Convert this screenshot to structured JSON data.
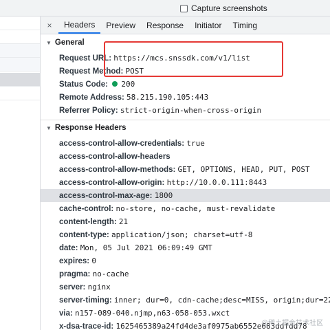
{
  "capture": {
    "label": "Capture screenshots"
  },
  "tabs": {
    "close_icon": "×",
    "items": [
      {
        "label": "Headers",
        "active": true
      },
      {
        "label": "Preview"
      },
      {
        "label": "Response"
      },
      {
        "label": "Initiator"
      },
      {
        "label": "Timing"
      }
    ]
  },
  "general": {
    "title": "General",
    "rows": [
      {
        "key": "Request URL:",
        "value": "https://mcs.snssdk.com/v1/list"
      },
      {
        "key": "Request Method:",
        "value": "POST"
      },
      {
        "key": "Status Code:",
        "value": "200",
        "status_color": "#0f9d58"
      },
      {
        "key": "Remote Address:",
        "value": "58.215.190.105:443"
      },
      {
        "key": "Referrer Policy:",
        "value": "strict-origin-when-cross-origin"
      }
    ]
  },
  "response_headers": {
    "title": "Response Headers",
    "rows": [
      {
        "key": "access-control-allow-credentials:",
        "value": "true"
      },
      {
        "key": "access-control-allow-headers",
        "value": ""
      },
      {
        "key": "access-control-allow-methods:",
        "value": "GET, OPTIONS, HEAD, PUT, POST"
      },
      {
        "key": "access-control-allow-origin:",
        "value": "http://10.0.0.111:8443"
      },
      {
        "key": "access-control-max-age:",
        "value": "1800"
      },
      {
        "key": "cache-control:",
        "value": "no-store, no-cache, must-revalidate"
      },
      {
        "key": "content-length:",
        "value": "21"
      },
      {
        "key": "content-type:",
        "value": "application/json; charset=utf-8"
      },
      {
        "key": "date:",
        "value": "Mon, 05 Jul 2021 06:09:49 GMT"
      },
      {
        "key": "expires:",
        "value": "0"
      },
      {
        "key": "pragma:",
        "value": "no-cache"
      },
      {
        "key": "server:",
        "value": "nginx"
      },
      {
        "key": "server-timing:",
        "value": "inner; dur=0, cdn-cache;desc=MISS,  origin;dur=22"
      },
      {
        "key": "via:",
        "value": "n157-089-040.njmp,n63-058-053.wxct"
      },
      {
        "key": "x-dsa-trace-id:",
        "value": "1625465389a24fd4de3af0975ab6552e683ddfdd78"
      }
    ]
  },
  "watermark": "@稀土掘金技术社区",
  "colors": {
    "accent": "#1a73e8",
    "highlight_box": "#e53935",
    "selected_row": "#dfe1e5"
  }
}
